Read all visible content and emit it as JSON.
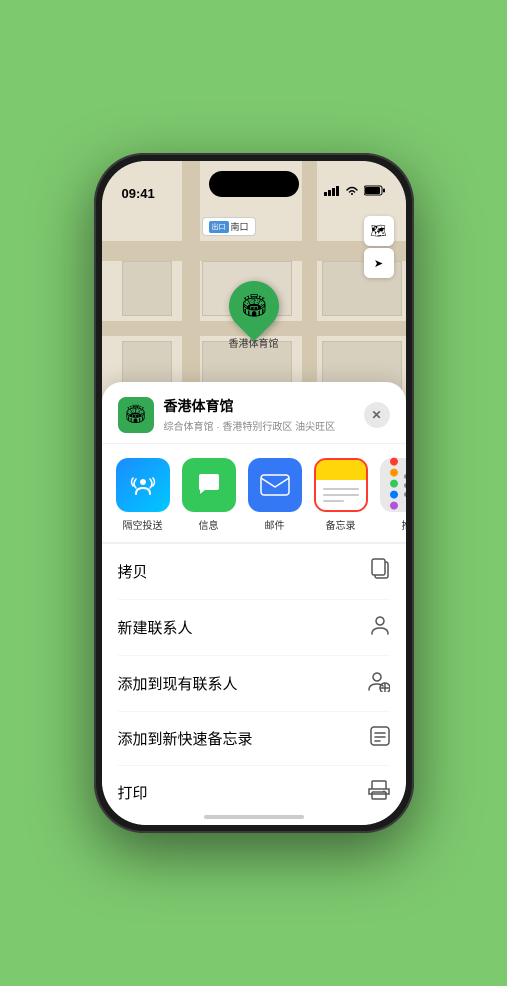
{
  "status_bar": {
    "time": "09:41",
    "location_icon": "▶",
    "signal": "▌▌▌",
    "wifi": "wifi",
    "battery": "🔋"
  },
  "map": {
    "label_badge": "出口",
    "label_text": "南口",
    "venue_marker": "🏟",
    "venue_name": "香港体育馆",
    "map_layer_icon": "🗺",
    "location_icon": "➤"
  },
  "venue": {
    "name": "香港体育馆",
    "subtitle": "综合体育馆 · 香港特别行政区 油尖旺区",
    "icon": "🏟"
  },
  "share_items": [
    {
      "id": "airdrop",
      "label": "隔空投送",
      "type": "airdrop"
    },
    {
      "id": "messages",
      "label": "信息",
      "type": "messages"
    },
    {
      "id": "mail",
      "label": "邮件",
      "type": "mail"
    },
    {
      "id": "notes",
      "label": "备忘录",
      "type": "notes",
      "selected": true
    },
    {
      "id": "more",
      "label": "推",
      "type": "more"
    }
  ],
  "actions": [
    {
      "id": "copy",
      "label": "拷贝",
      "icon": "copy"
    },
    {
      "id": "new-contact",
      "label": "新建联系人",
      "icon": "person"
    },
    {
      "id": "add-contact",
      "label": "添加到现有联系人",
      "icon": "person-add"
    },
    {
      "id": "quick-note",
      "label": "添加到新快速备忘录",
      "icon": "note"
    },
    {
      "id": "print",
      "label": "打印",
      "icon": "print"
    }
  ],
  "colored_dots": [
    {
      "color": "#ff3b30"
    },
    {
      "color": "#ff9500"
    },
    {
      "color": "#34c759"
    },
    {
      "color": "#007aff"
    },
    {
      "color": "#af52de"
    }
  ]
}
